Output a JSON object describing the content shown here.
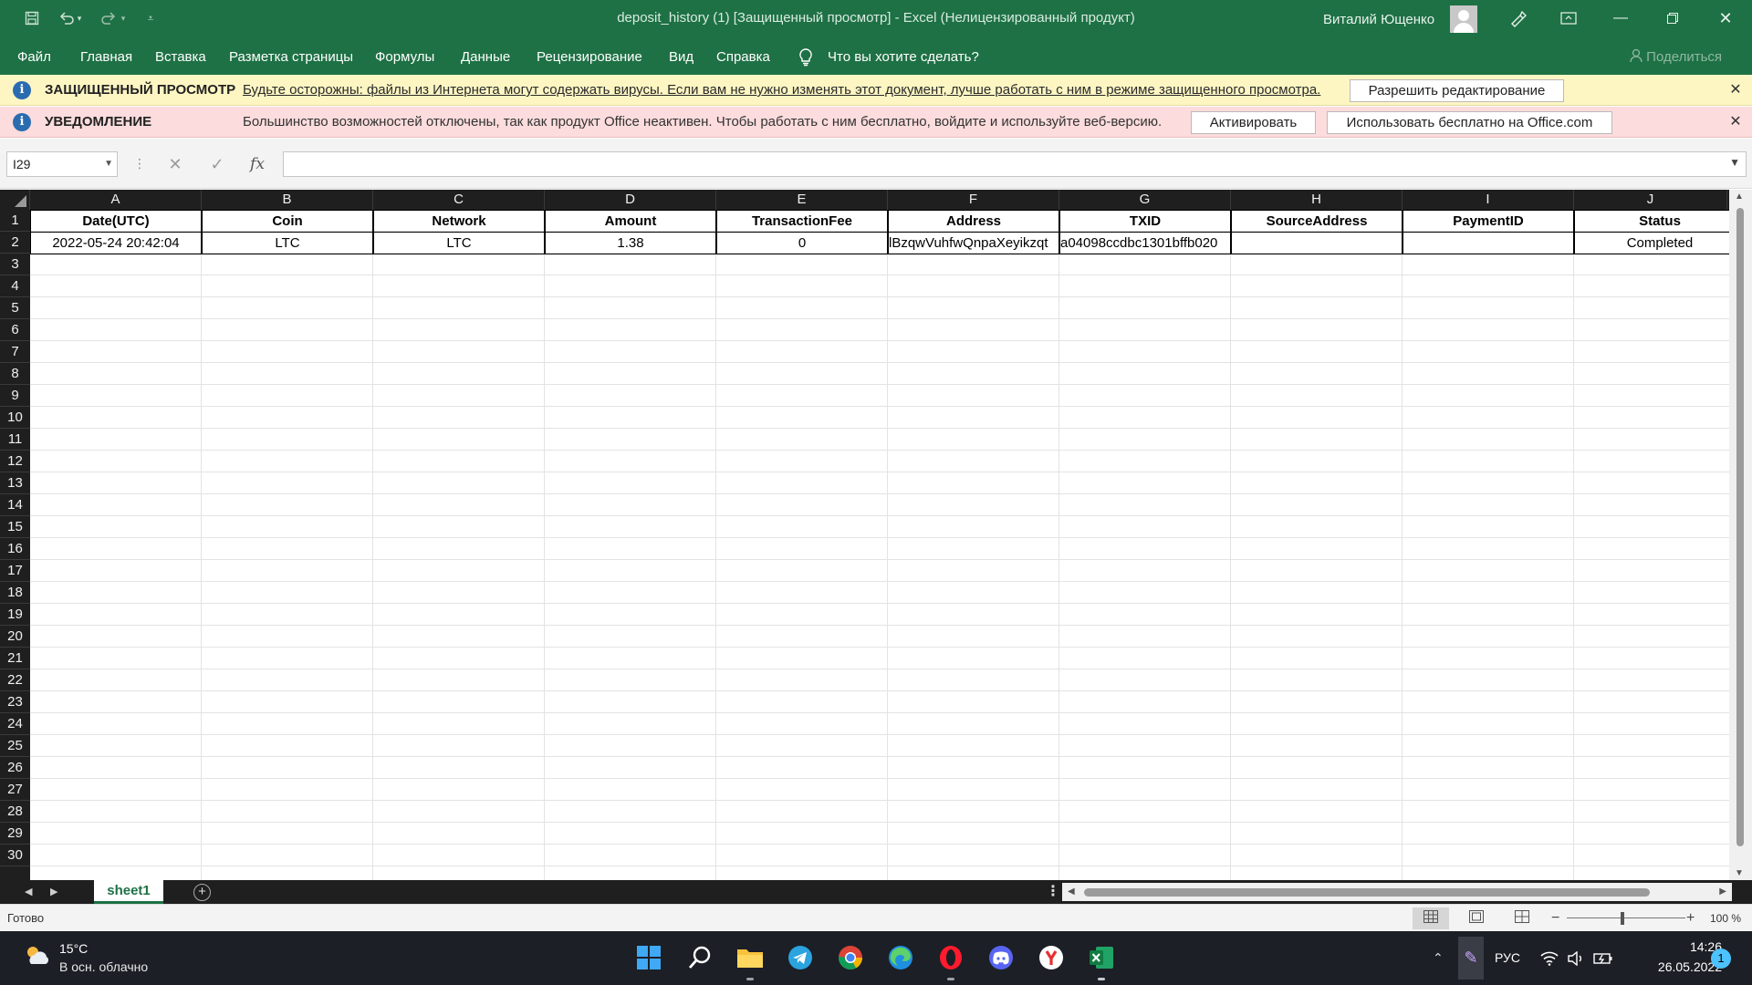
{
  "titlebar": {
    "title": "deposit_history (1)  [Защищенный просмотр]  -  Excel (Нелицензированный продукт)",
    "user_name": "Виталий Ющенко"
  },
  "menu": {
    "items": [
      "Файл",
      "Главная",
      "Вставка",
      "Разметка страницы",
      "Формулы",
      "Данные",
      "Рецензирование",
      "Вид",
      "Справка"
    ],
    "tell_me": "Что вы хотите сделать?",
    "share": "Поделиться"
  },
  "protected_bar": {
    "title": "ЗАЩИЩЕННЫЙ ПРОСМОТР",
    "text": "Будьте осторожны: файлы из Интернета могут содержать вирусы. Если вам не нужно изменять этот документ, лучше работать с ним в режиме защищенного просмотра.",
    "button": "Разрешить редактирование",
    "close": "✕"
  },
  "notice_bar": {
    "title": "УВЕДОМЛЕНИЕ",
    "text": "Большинство возможностей отключены, так как продукт Office неактивен. Чтобы работать с ним бесплатно, войдите и используйте веб-версию.",
    "activate_button": "Активировать",
    "free_button": "Использовать бесплатно на Office.com",
    "close": "✕"
  },
  "formula_bar": {
    "name_box": "I29",
    "fx": "fx",
    "value": ""
  },
  "sheet": {
    "columns": [
      "A",
      "B",
      "C",
      "D",
      "E",
      "F",
      "G",
      "H",
      "I",
      "J"
    ],
    "rows": [
      "1",
      "2",
      "3",
      "4",
      "5",
      "6",
      "7",
      "8",
      "9",
      "10",
      "11",
      "12",
      "13",
      "14",
      "15",
      "16",
      "17",
      "18",
      "19",
      "20",
      "21",
      "22",
      "23",
      "24",
      "25",
      "26",
      "27",
      "28",
      "29",
      "30"
    ],
    "header_row": [
      "Date(UTC)",
      "Coin",
      "Network",
      "Amount",
      "TransactionFee",
      "Address",
      "TXID",
      "SourceAddress",
      "PaymentID",
      "Status"
    ],
    "data_rows": [
      [
        "2022-05-24 20:42:04",
        "LTC",
        "LTC",
        "1.38",
        "0",
        "lBzqwVuhfwQnpaXeyikzqt",
        "a04098ccdbc1301bffb020",
        "",
        "",
        "Completed"
      ]
    ]
  },
  "tabs": {
    "sheets": [
      "sheet1"
    ]
  },
  "status": {
    "text": "Готово",
    "zoom": "100 %"
  },
  "taskbar": {
    "temperature": "15°C",
    "weather": "В осн. облачно",
    "language": "РУС",
    "time": "14:26",
    "date": "26.05.2022",
    "notifications": "1"
  },
  "colors": {
    "excel_green": "#1e7145",
    "protected_bar": "#fdf6c3",
    "notice_bar": "#fcdcdc",
    "header_dark": "#1f1f1f"
  }
}
